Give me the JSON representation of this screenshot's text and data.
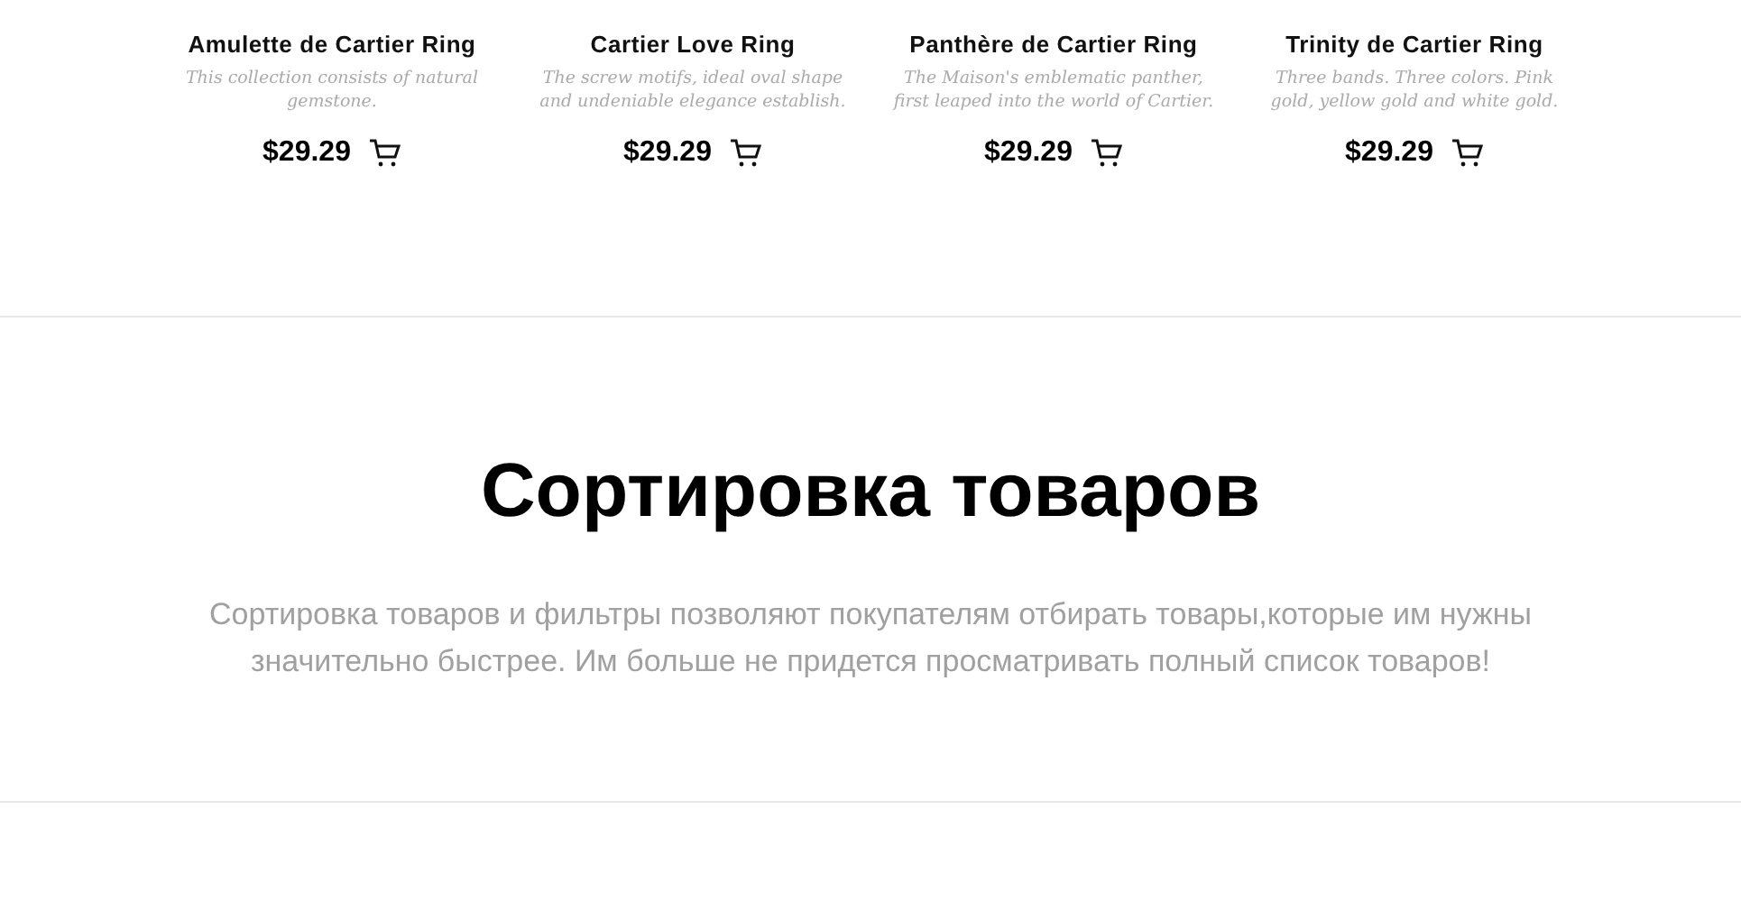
{
  "products": [
    {
      "name": "Amulette de Cartier Ring",
      "description": "This collection consists of natural gemstone.",
      "price": "$29.29"
    },
    {
      "name": "Cartier Love Ring",
      "description": "The screw motifs, ideal oval shape and undeniable elegance establish.",
      "price": "$29.29"
    },
    {
      "name": "Panthère de Cartier Ring",
      "description": "The Maison's emblematic panther, first leaped into the world of Cartier.",
      "price": "$29.29"
    },
    {
      "name": "Trinity de Cartier Ring",
      "description": "Three bands. Three colors. Pink gold, yellow gold and white gold.",
      "price": "$29.29"
    }
  ],
  "section": {
    "title": "Сортировка товаров",
    "text": "Сортировка товаров и фильтры позволяют покупателям отбирать товары,которые им нужны значительно быстрее. Им больше не придется просматривать полный список товаров!"
  }
}
